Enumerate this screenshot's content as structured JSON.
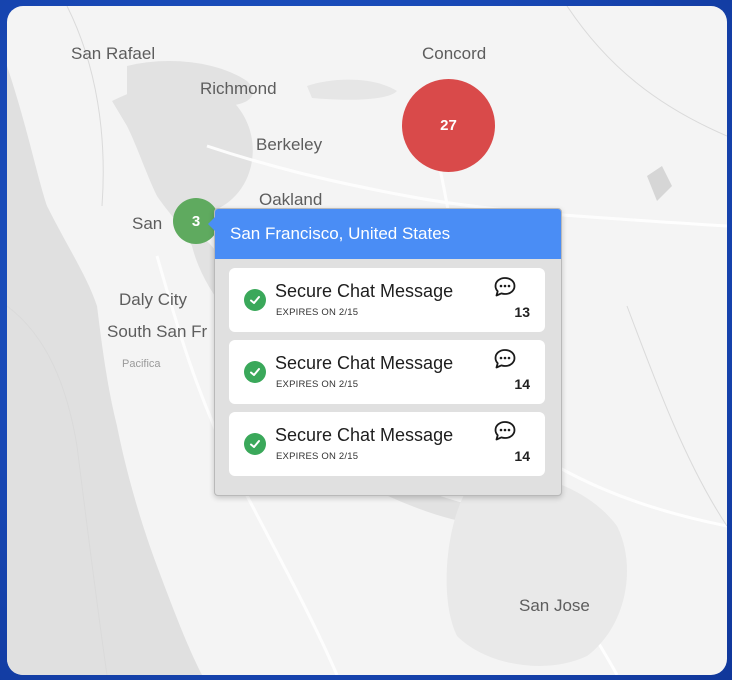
{
  "map": {
    "labels": {
      "san_rafael": "San Rafael",
      "concord": "Concord",
      "richmond": "Richmond",
      "berkeley": "Berkeley",
      "oakland": "Oakland",
      "san_francisco_partial": "San",
      "daly_city": "Daly City",
      "south_san_francisco_partial": "South San Fr",
      "pacifica": "Pacifica",
      "san_jose": "San Jose"
    },
    "clusters": [
      {
        "count": "27",
        "color": "#d94a4a"
      },
      {
        "count": "3",
        "color": "#5faa5f"
      }
    ]
  },
  "popup": {
    "title": "San Francisco, United States",
    "header_color": "#4a8df5",
    "items": [
      {
        "title": "Secure Chat Message",
        "subtitle": "EXPIRES ON 2/15",
        "count": "13",
        "icon": "chat-bubble-icon",
        "status_icon": "check-circle-icon"
      },
      {
        "title": "Secure Chat Message",
        "subtitle": "EXPIRES ON 2/15",
        "count": "14",
        "icon": "chat-bubble-icon",
        "status_icon": "check-circle-icon"
      },
      {
        "title": "Secure Chat Message",
        "subtitle": "EXPIRES ON 2/15",
        "count": "14",
        "icon": "chat-bubble-icon",
        "status_icon": "check-circle-icon"
      }
    ]
  },
  "colors": {
    "background": "#1848b5",
    "map_land": "#f4f4f4",
    "map_water": "#e2e2e2",
    "check_green": "#3aa85a"
  }
}
